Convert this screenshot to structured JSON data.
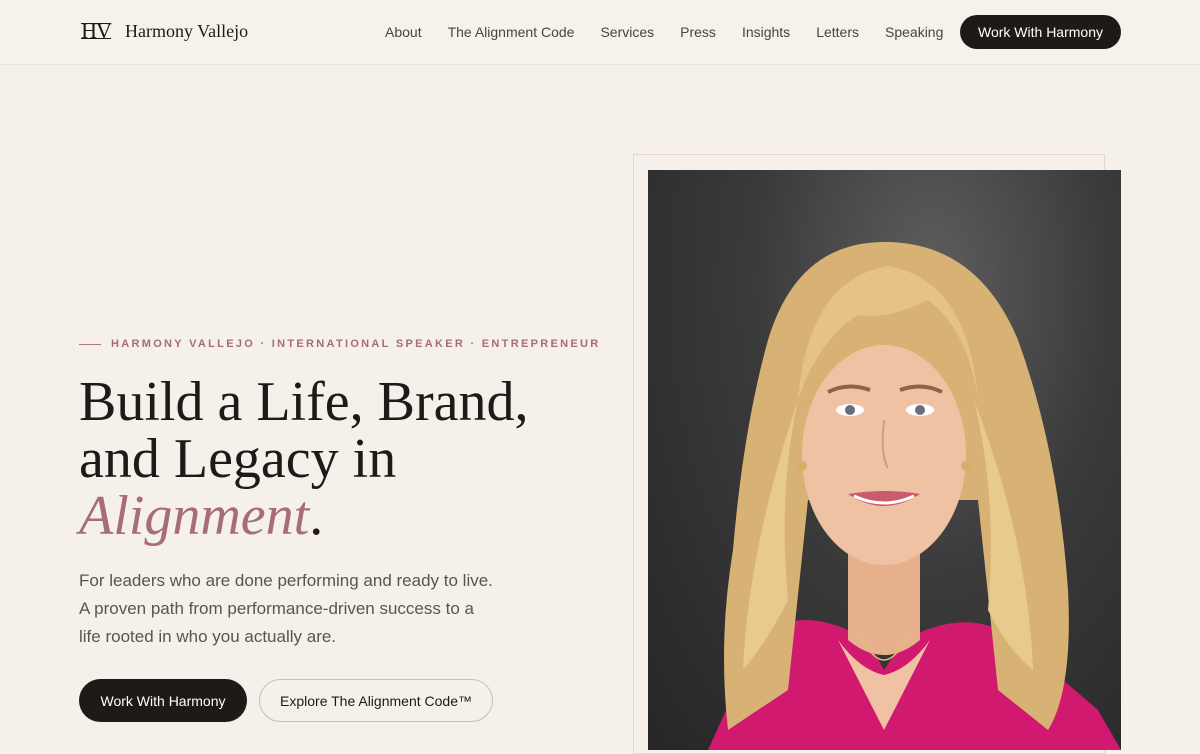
{
  "brand": {
    "monogram": "HV",
    "name": "Harmony Vallejo"
  },
  "nav": {
    "items": [
      {
        "label": "About"
      },
      {
        "label": "The Alignment Code"
      },
      {
        "label": "Services"
      },
      {
        "label": "Press"
      },
      {
        "label": "Insights"
      },
      {
        "label": "Letters"
      },
      {
        "label": "Speaking"
      }
    ],
    "cta_label": "Work With Harmony"
  },
  "hero": {
    "eyebrow": "HARMONY VALLEJO · INTERNATIONAL SPEAKER · ENTREPRENEUR",
    "headline_line1": "Build a Life, Brand,",
    "headline_line2": "and Legacy in",
    "headline_accent": "Alignment",
    "headline_period": ".",
    "subtext_line1": "For leaders who are done performing and ready to live.",
    "subtext_line2": "A proven path from performance-driven success to a",
    "subtext_line3": "life rooted in who you actually are.",
    "primary_cta": "Work With Harmony",
    "secondary_cta": "Explore The Alignment Code™"
  },
  "colors": {
    "accent": "#a66d73",
    "dark": "#1f1a17",
    "background": "#f6f0ea"
  }
}
